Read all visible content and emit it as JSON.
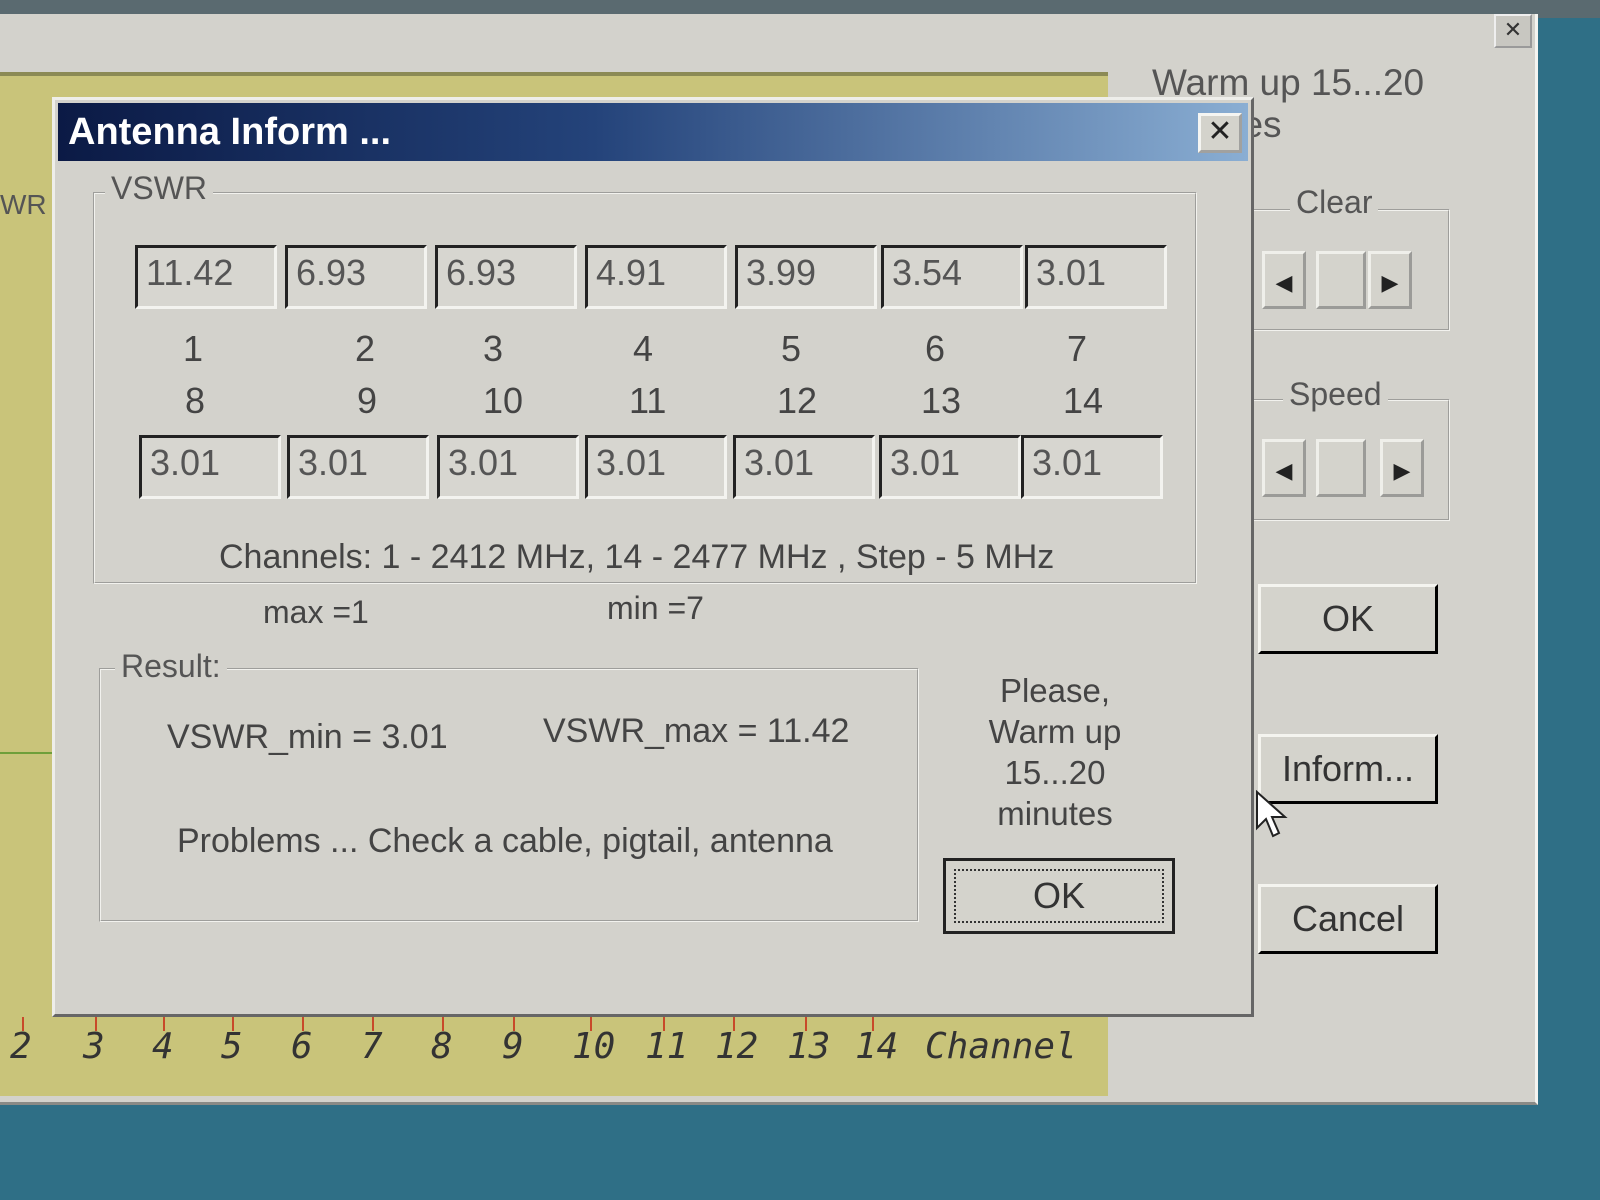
{
  "background_window": {
    "warm_label": "Warm up 15...20 minutes",
    "side_label": "WR",
    "clear_group": {
      "title": "Clear"
    },
    "speed_group": {
      "title": "Speed"
    },
    "buttons": {
      "ok": "OK",
      "inform": "Inform...",
      "cancel": "Cancel"
    },
    "axis": {
      "ticks": [
        "2",
        "3",
        "4",
        "5",
        "6",
        "7",
        "8",
        "9",
        "10",
        "11",
        "12",
        "13",
        "14"
      ],
      "label": "Channel"
    }
  },
  "dialog": {
    "title": "Antenna Inform ...",
    "vswr_group_title": "VSWR",
    "row1": {
      "values": [
        "11.42",
        "6.93",
        "6.93",
        "4.91",
        "3.99",
        "3.54",
        "3.01"
      ],
      "channels": [
        "1",
        "2",
        "3",
        "4",
        "5",
        "6",
        "7"
      ]
    },
    "row2": {
      "channels": [
        "8",
        "9",
        "10",
        "11",
        "12",
        "13",
        "14"
      ],
      "values": [
        "3.01",
        "3.01",
        "3.01",
        "3.01",
        "3.01",
        "3.01",
        "3.01"
      ]
    },
    "channels_info": "Channels:  1 - 2412 MHz,  14 - 2477 MHz ,  Step - 5 MHz",
    "max_text": "max =1",
    "min_text": "min =7",
    "result": {
      "title": "Result:",
      "vswr_min": "VSWR_min = 3.01",
      "vswr_max": "VSWR_max = 11.42",
      "message": "Problems ... Check a cable, pigtail, antenna"
    },
    "please": [
      "Please,",
      "Warm up",
      "15...20",
      "minutes"
    ],
    "ok_label": "OK"
  },
  "colors": {
    "titlebar_start": "#0b1a45",
    "titlebar_end": "#8aaed3",
    "graph_bg": "#c9c47a"
  }
}
